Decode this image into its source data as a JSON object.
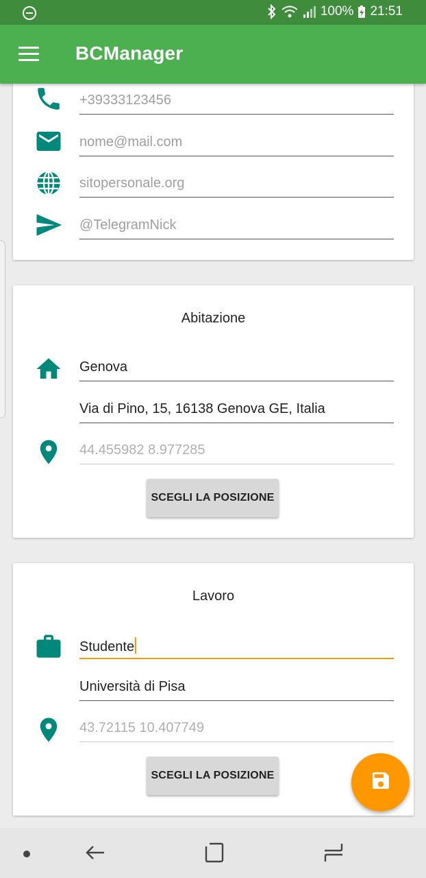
{
  "status_bar": {
    "battery": "100%",
    "time": "21:51"
  },
  "app_bar": {
    "title": "BCManager",
    "menu_icon": "menu-icon"
  },
  "contacts": {
    "phone": {
      "icon": "phone-icon",
      "hint": "+39333123456"
    },
    "email": {
      "icon": "email-icon",
      "hint": "nome@mail.com"
    },
    "website": {
      "icon": "globe-icon",
      "hint": "sitopersonale.org"
    },
    "telegram": {
      "icon": "send-icon",
      "hint": "@TelegramNick"
    }
  },
  "home": {
    "title": "Abitazione",
    "city": "Genova",
    "address": "Via di Pino, 15, 16138 Genova GE, Italia",
    "coords_hint": "44.455982 8.977285",
    "button_label": "SCEGLI LA POSIZIONE"
  },
  "work": {
    "title": "Lavoro",
    "job": "Studente",
    "place": "Università di Pisa",
    "coords_hint": "43.72115 10.407749",
    "button_label": "SCEGLI LA POSIZIONE"
  },
  "colors": {
    "primary": "#4caf50",
    "primary_dark": "#3f8c3d",
    "accent": "#ff9800",
    "icon": "#00897b"
  }
}
